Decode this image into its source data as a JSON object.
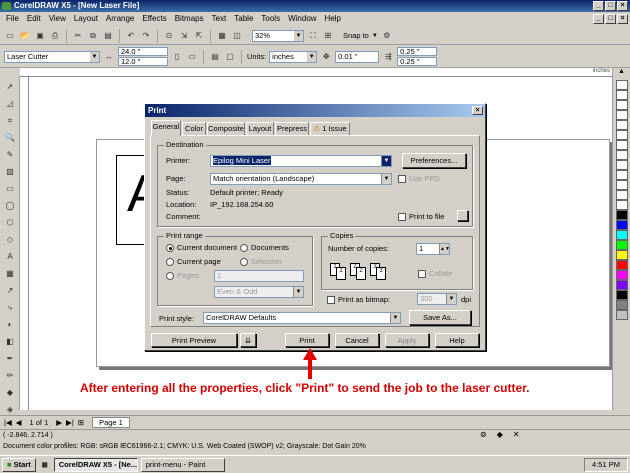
{
  "window": {
    "title": "CorelDRAW X5 - [New Laser File]"
  },
  "menu": [
    "File",
    "Edit",
    "View",
    "Layout",
    "Arrange",
    "Effects",
    "Bitmaps",
    "Text",
    "Table",
    "Tools",
    "Window",
    "Help"
  ],
  "toolbar1": {
    "zoom": "32%",
    "snap_to": "Snap to"
  },
  "propbar": {
    "preset": "Laser Cutter",
    "width": "24.0 \"",
    "height": "12.0 \"",
    "units_label": "Units:",
    "units": "inches",
    "nudge": "0.01 \"",
    "dup_x": "0.25 \"",
    "dup_y": "0.25 \""
  },
  "ruler": {
    "units": "inches"
  },
  "canvas": {
    "glyph": "A"
  },
  "palette": {
    "colors": [
      "#ffffff",
      "#ffffff",
      "#ffffff",
      "#ffffff",
      "#ffffff",
      "#ffffff",
      "#ffffff",
      "#ffffff",
      "#ffffff",
      "#ffffff",
      "#ffffff",
      "#ffffff",
      "#ffffff",
      "#000000",
      "#0000ff",
      "#00ffff",
      "#00ff00",
      "#ffff00",
      "#ff0000",
      "#ff00ff",
      "#8000ff",
      "#000000",
      "#808080",
      "#c0c0c0"
    ]
  },
  "dialog": {
    "title": "Print",
    "tabs": [
      "General",
      "Color",
      "Composite",
      "Layout",
      "Prepress",
      "1 Issue"
    ],
    "destination": {
      "title": "Destination",
      "printer_label": "Printer:",
      "printer": "Epilog Mini Laser",
      "preferences": "Preferences...",
      "page_label": "Page:",
      "page": "Match orientation (Landscape)",
      "use_ppd": "Use PPD",
      "status_label": "Status:",
      "status": "Default printer; Ready",
      "location_label": "Location:",
      "location": "IP_192.168.254.60",
      "comment_label": "Comment:",
      "print_to_file": "Print to file"
    },
    "print_range": {
      "title": "Print range",
      "current_document": "Current document",
      "documents": "Documents",
      "current_page": "Current page",
      "selection": "Selection",
      "pages": "Pages:",
      "pages_value": "1",
      "even_odd": "Even & Odd"
    },
    "copies": {
      "title": "Copies",
      "number_label": "Number of copies:",
      "number": "1",
      "collate": "Collate",
      "page_icons": [
        "1",
        "1",
        "2",
        "2",
        "3",
        "3"
      ]
    },
    "print_as_bitmap": "Print as bitmap:",
    "dpi_value": "300",
    "dpi": "dpi",
    "print_style_label": "Print style:",
    "print_style": "CorelDRAW Defaults",
    "save_as": "Save As...",
    "buttons": {
      "print_preview": "Print Preview",
      "print": "Print",
      "cancel": "Cancel",
      "apply": "Apply",
      "help": "Help"
    }
  },
  "pagenav": {
    "counter": "1 of 1",
    "page_tab": "Page 1"
  },
  "status": {
    "coords": "( -2.846, 2.714 )",
    "profiles": "Document color profiles: RGB: sRGB IEC61966-2.1; CMYK: U.S. Web Coated (SWOP) v2; Grayscale: Dot Gain 20%"
  },
  "annotation": "After entering all the properties, click \"Print\" to send the job to the laser cutter.",
  "taskbar": {
    "start": "Start",
    "items": [
      "CorelDRAW X5 - [Ne...",
      "print-menu - Paint"
    ],
    "clock": "4:51 PM"
  }
}
